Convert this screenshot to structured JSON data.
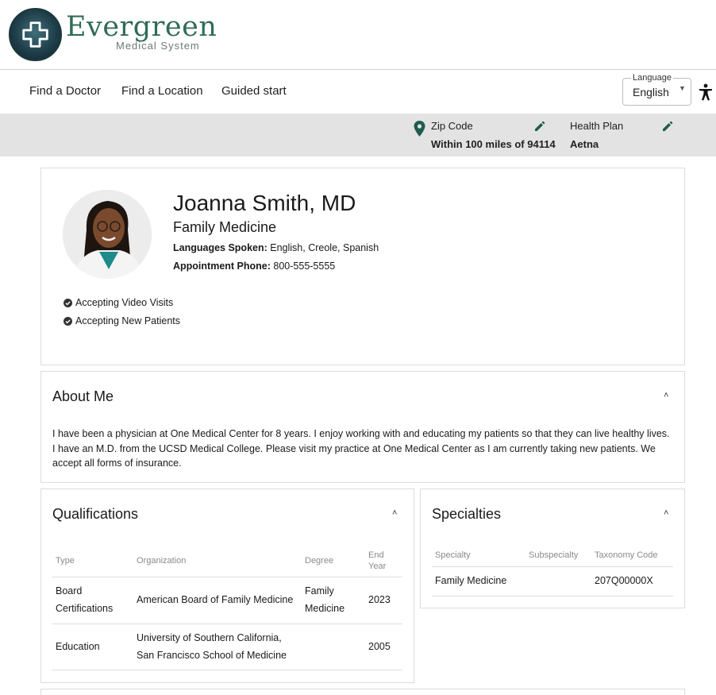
{
  "brand": {
    "name": "Evergreen",
    "subtitle": "Medical System",
    "accent_color": "#2f6b58"
  },
  "nav": {
    "links": [
      "Find a Doctor",
      "Find a Location",
      "Guided start"
    ],
    "language": {
      "label": "Language",
      "value": "English"
    }
  },
  "filters": {
    "zip": {
      "label": "Zip Code",
      "value": "Within 100 miles of 94114"
    },
    "plan": {
      "label": "Health Plan",
      "value": "Aetna"
    }
  },
  "profile": {
    "name": "Joanna Smith, MD",
    "specialty": "Family Medicine",
    "languages_label": "Languages Spoken:",
    "languages_value": "English, Creole, Spanish",
    "phone_label": "Appointment Phone:",
    "phone_value": "800-555-5555",
    "badges": [
      "Accepting Video Visits",
      "Accepting New Patients"
    ]
  },
  "about": {
    "title": "About Me",
    "text": "I have been a physician at One Medical Center for 8 years. I enjoy working with and educating my patients so that they can live healthy lives. I have an M.D. from the UCSD Medical College. Please visit my practice at One Medical Center as I am currently taking new patients. We accept all forms of insurance."
  },
  "qualifications": {
    "title": "Qualifications",
    "columns": [
      "Type",
      "Organization",
      "Degree",
      "End Year"
    ],
    "rows": [
      {
        "type": "Board Certifications",
        "organization": "American Board of Family Medicine",
        "degree": "Family Medicine",
        "end_year": "2023"
      },
      {
        "type": "Education",
        "organization": "University of Southern California, San Francisco School of Medicine",
        "degree": "",
        "end_year": "2005"
      }
    ]
  },
  "specialties": {
    "title": "Specialties",
    "columns": [
      "Specialty",
      "Subspecialty",
      "Taxonomy Code"
    ],
    "rows": [
      {
        "specialty": "Family Medicine",
        "subspecialty": "",
        "taxonomy": "207Q00000X"
      }
    ]
  },
  "icons": {
    "logo": "medical-cross-icon",
    "accessibility": "accessibility-icon",
    "location": "map-pin-icon",
    "edit": "pencil-icon",
    "check": "check-circle-icon",
    "collapse": "chevron-up-icon"
  }
}
